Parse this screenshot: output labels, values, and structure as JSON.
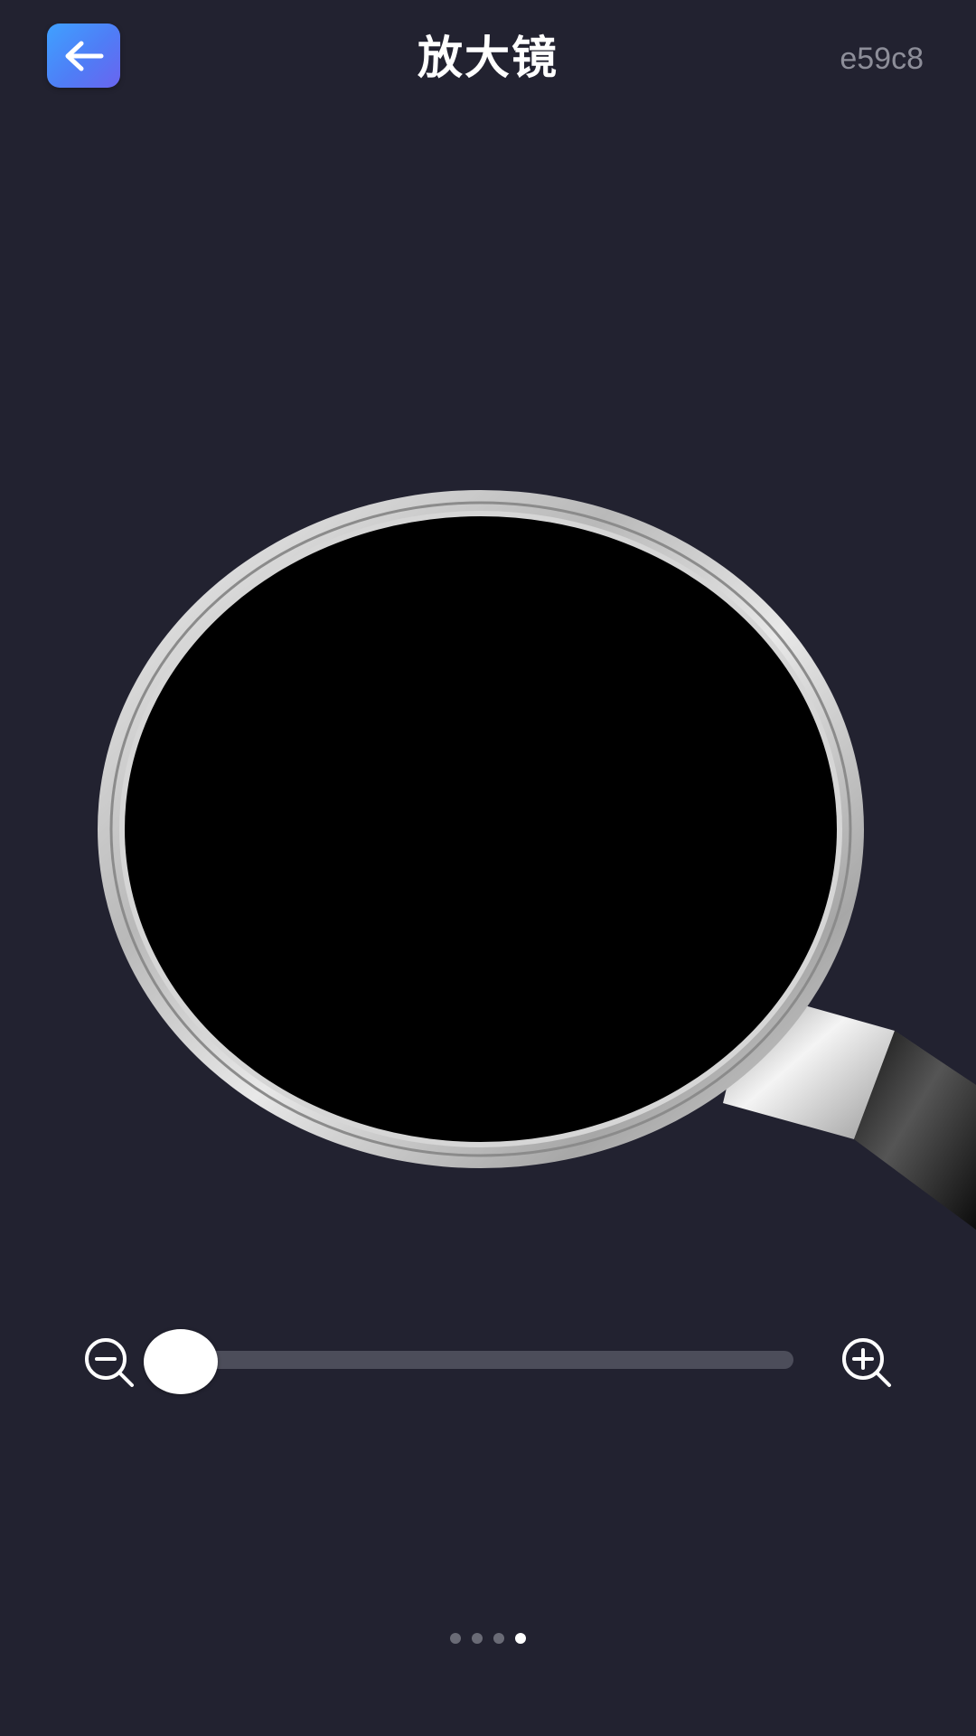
{
  "header": {
    "back_icon": "arrow-left-icon",
    "title": "放大镜",
    "code": "e59c8"
  },
  "colors": {
    "background": "#222230",
    "back_button_gradient": [
      "#3fa1ff",
      "#6a64ef"
    ],
    "lens": "#000000",
    "track": "#4c4d5a",
    "thumb": "#ffffff"
  },
  "zoom": {
    "minus_icon": "zoom-out-icon",
    "plus_icon": "zoom-in-icon",
    "level": 0.0
  },
  "pager": {
    "count": 4,
    "active_index": 3
  }
}
